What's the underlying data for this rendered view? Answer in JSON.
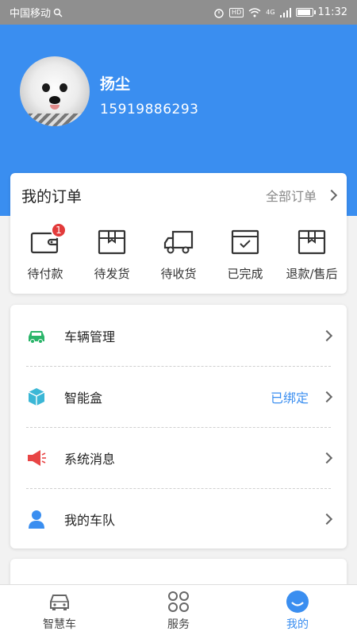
{
  "status_bar": {
    "carrier": "中国移动",
    "hd": "HD",
    "signal": "4G",
    "time": "11:32",
    "battery_level": 0.8
  },
  "profile": {
    "name": "扬尘",
    "phone": "15919886293"
  },
  "orders": {
    "title": "我的订单",
    "all_label": "全部订单",
    "items": [
      {
        "label": "待付款",
        "icon": "wallet-icon",
        "badge": "1"
      },
      {
        "label": "待发货",
        "icon": "box-icon"
      },
      {
        "label": "待收货",
        "icon": "truck-icon"
      },
      {
        "label": "已完成",
        "icon": "check-box-icon"
      },
      {
        "label": "退款/售后",
        "icon": "refund-box-icon"
      }
    ]
  },
  "menu": [
    {
      "label": "车辆管理",
      "icon": "car-icon",
      "icon_color": "#2bb56a"
    },
    {
      "label": "智能盒",
      "icon": "cube-icon",
      "icon_color": "#3bb7d6",
      "status": "已绑定"
    },
    {
      "label": "系统消息",
      "icon": "megaphone-icon",
      "icon_color": "#e84545"
    },
    {
      "label": "我的车队",
      "icon": "person-icon",
      "icon_color": "#3a8ef0"
    }
  ],
  "bottom_nav": [
    {
      "label": "智慧车",
      "icon": "car-outline-icon"
    },
    {
      "label": "服务",
      "icon": "grid-icon"
    },
    {
      "label": "我的",
      "icon": "smile-icon",
      "active": true
    }
  ],
  "colors": {
    "primary": "#3a8ef0",
    "badge": "#e23a3a"
  }
}
